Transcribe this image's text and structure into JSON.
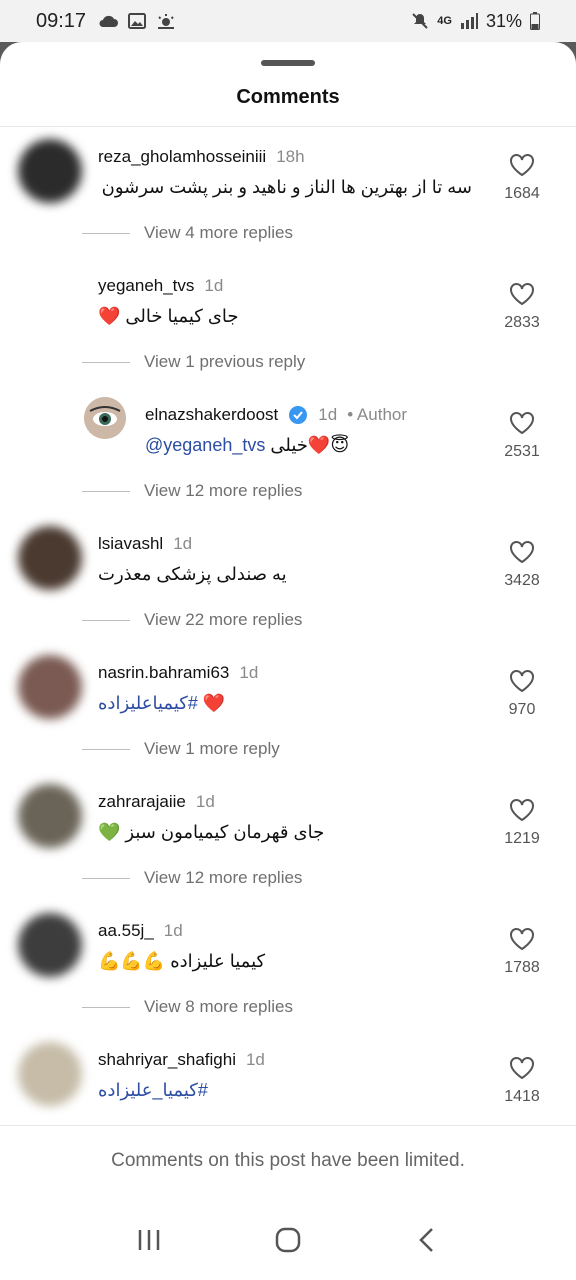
{
  "status": {
    "time": "09:17",
    "network": "4G",
    "battery": "31%"
  },
  "sheet": {
    "title": "Comments",
    "limited_notice": "Comments on this post have been limited."
  },
  "comments": [
    {
      "username": "reza_gholamhosseiniii",
      "time": "18h",
      "text": "سه تا از بهترین ها الناز و ناهید و بنر پشت سرشون",
      "replies": "View 4 more replies",
      "likes": "1684",
      "avatar_color": "#2b2b2b"
    },
    {
      "username": "yeganeh_tvs",
      "time": "1d",
      "text": "جای کیمیا خالی ❤️",
      "replies": "View 1 previous reply",
      "likes": "2833"
    },
    {
      "username": "elnazshakerdoost",
      "time": "1d",
      "author_tag": "• Author",
      "mention": "@yeganeh_tvs",
      "text": "خیلی❤️😇",
      "replies": "View 12 more replies",
      "likes": "2531"
    },
    {
      "username": "lsiavashl",
      "time": "1d",
      "text": "یه صندلی پزشکی معذرت",
      "replies": "View 22 more replies",
      "likes": "3428",
      "avatar_color": "#4a3a30"
    },
    {
      "username": "nasrin.bahrami63",
      "time": "1d",
      "hashtag": "#کیمیاعلیزاده",
      "text": "❤️",
      "replies": "View 1 more reply",
      "likes": "970",
      "avatar_color": "#7a5a52"
    },
    {
      "username": "zahrarajaiie",
      "time": "1d",
      "text": "جای قهرمان کیمیامون سبز 💚",
      "replies": "View 12 more replies",
      "likes": "1219",
      "avatar_color": "#6a6458"
    },
    {
      "username": "aa.55j_",
      "time": "1d",
      "text": "کیمیا علیزاده 💪💪💪",
      "replies": "View 8 more replies",
      "likes": "1788",
      "avatar_color": "#3d3d3d"
    },
    {
      "username": "shahriyar_shafighi",
      "time": "1d",
      "hashtag": "#کیمیا_علیزاده",
      "likes": "1418",
      "avatar_color": "#c6bca8"
    }
  ]
}
